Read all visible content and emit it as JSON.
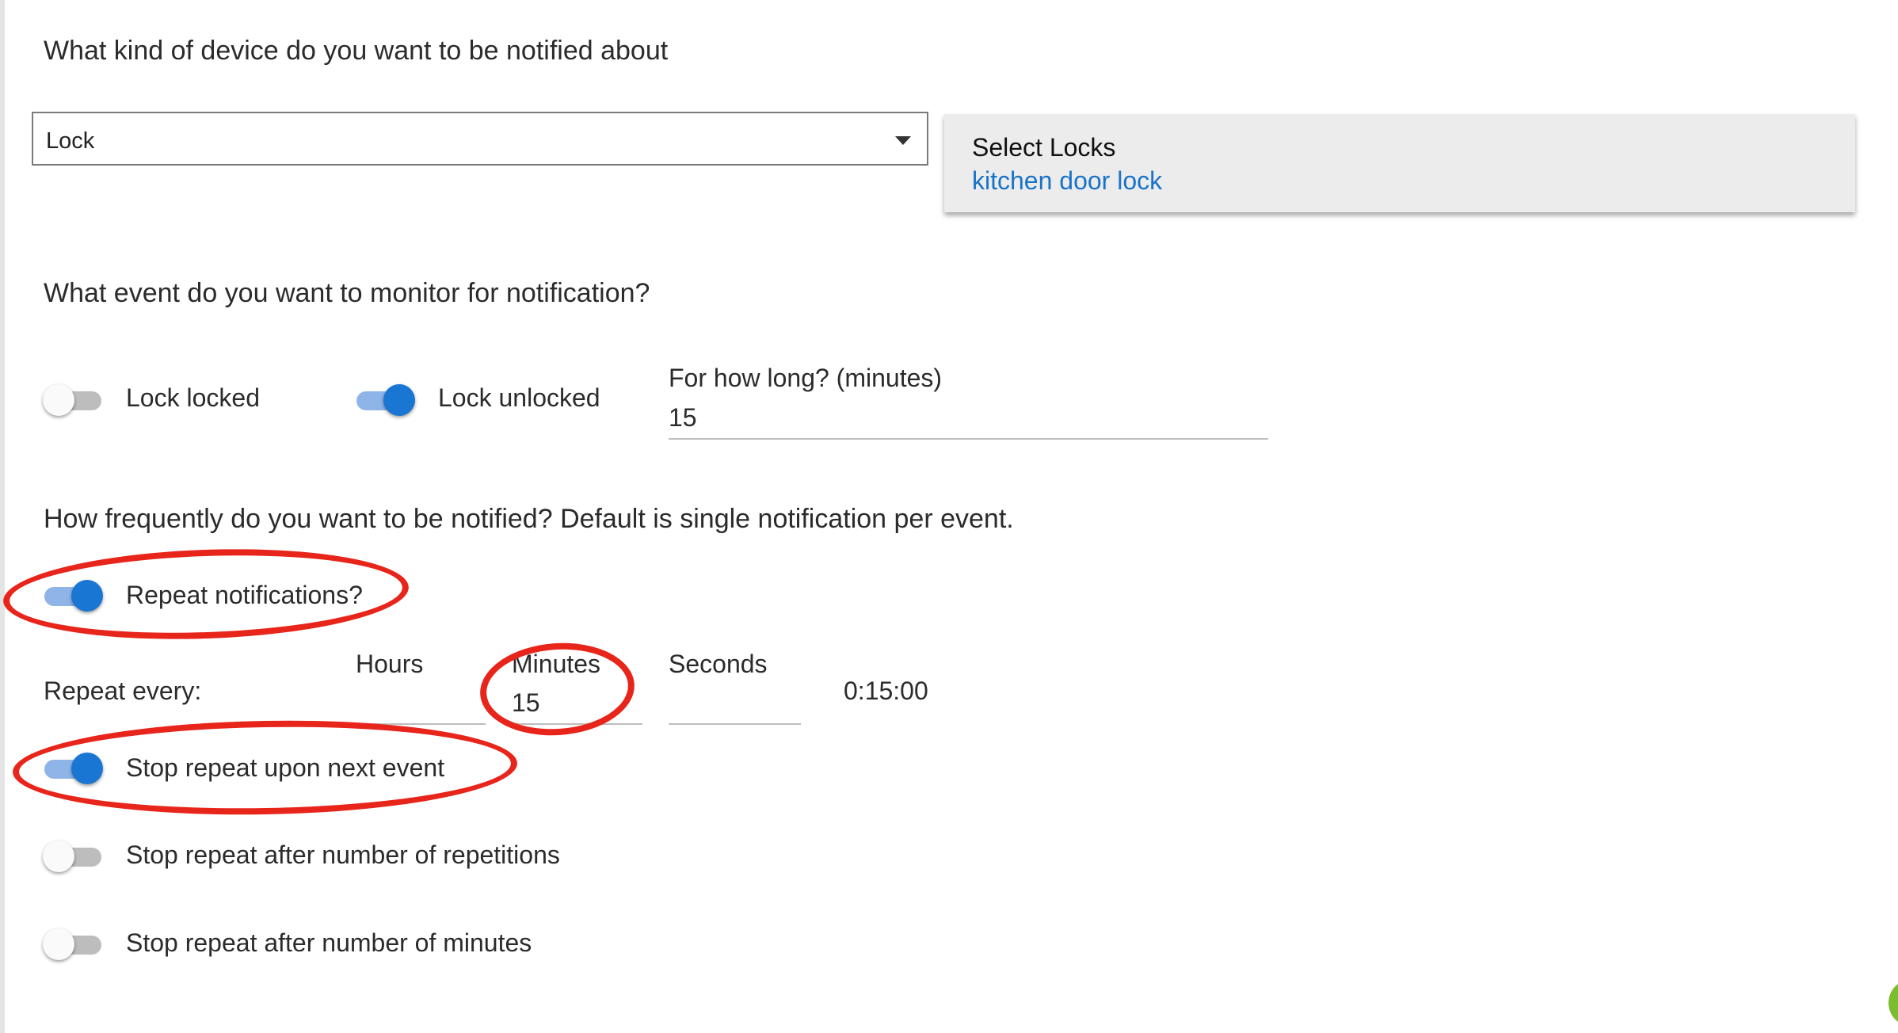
{
  "device": {
    "question": "What kind of device do you want to be notified about",
    "selected": "Lock",
    "card_title": "Select Locks",
    "card_link": "kitchen door lock"
  },
  "event": {
    "question": "What event do you want to monitor for notification?",
    "lock_locked": {
      "label": "Lock locked",
      "on": false
    },
    "lock_unlocked": {
      "label": "Lock unlocked",
      "on": true
    },
    "duration_label": "For how long? (minutes)",
    "duration_value": "15"
  },
  "frequency": {
    "question": "How frequently do you want to be notified?  Default is single notification per event.",
    "repeat": {
      "label": "Repeat notifications?",
      "on": true
    },
    "repeat_every_label": "Repeat every:",
    "hours_label": "Hours",
    "minutes_label": "Minutes",
    "minutes_value": "15",
    "seconds_label": "Seconds",
    "total": "0:15:00",
    "stop_next_event": {
      "label": "Stop repeat upon next event",
      "on": true
    },
    "stop_after_repetitions": {
      "label": "Stop repeat after number of repetitions",
      "on": false
    },
    "stop_after_minutes": {
      "label": "Stop repeat after number of minutes",
      "on": false
    }
  },
  "colors": {
    "accent": "#1976d2",
    "link": "#1a73c8",
    "annotation": "#e8251b"
  },
  "icons": {
    "dropdown": "caret-down-icon"
  }
}
